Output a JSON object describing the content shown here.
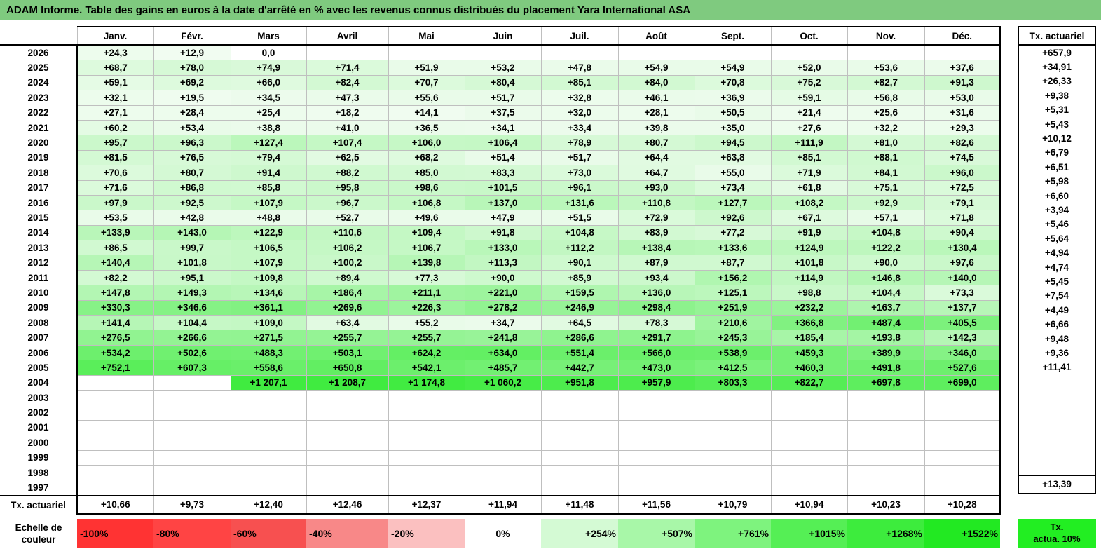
{
  "title": "ADAM Informe. Table des gains en euros à la date d'arrêté en % avec les revenus connus distribués du placement Yara International ASA",
  "months": [
    "Janv.",
    "Févr.",
    "Mars",
    "Avril",
    "Mai",
    "Juin",
    "Juil.",
    "Août",
    "Sept.",
    "Oct.",
    "Nov.",
    "Déc."
  ],
  "side_header": "Tx. actuariel",
  "rows": [
    {
      "year": "2026",
      "values": [
        "+24,3",
        "+12,9",
        "0,0",
        "",
        "",
        "",
        "",
        "",
        "",
        "",
        "",
        ""
      ],
      "rate": "+657,9"
    },
    {
      "year": "2025",
      "values": [
        "+68,7",
        "+78,0",
        "+74,9",
        "+71,4",
        "+51,9",
        "+53,2",
        "+47,8",
        "+54,9",
        "+54,9",
        "+52,0",
        "+53,6",
        "+37,6"
      ],
      "rate": "+34,91"
    },
    {
      "year": "2024",
      "values": [
        "+59,1",
        "+69,2",
        "+66,0",
        "+82,4",
        "+70,7",
        "+80,4",
        "+85,1",
        "+84,0",
        "+70,8",
        "+75,2",
        "+82,7",
        "+91,3"
      ],
      "rate": "+26,33"
    },
    {
      "year": "2023",
      "values": [
        "+32,1",
        "+19,5",
        "+34,5",
        "+47,3",
        "+55,6",
        "+51,7",
        "+32,8",
        "+46,1",
        "+36,9",
        "+59,1",
        "+56,8",
        "+53,0"
      ],
      "rate": "+9,38"
    },
    {
      "year": "2022",
      "values": [
        "+27,1",
        "+28,4",
        "+25,4",
        "+18,2",
        "+14,1",
        "+37,5",
        "+32,0",
        "+28,1",
        "+50,5",
        "+21,4",
        "+25,6",
        "+31,6"
      ],
      "rate": "+5,31"
    },
    {
      "year": "2021",
      "values": [
        "+60,2",
        "+53,4",
        "+38,8",
        "+41,0",
        "+36,5",
        "+34,1",
        "+33,4",
        "+39,8",
        "+35,0",
        "+27,6",
        "+32,2",
        "+29,3"
      ],
      "rate": "+5,43"
    },
    {
      "year": "2020",
      "values": [
        "+95,7",
        "+96,3",
        "+127,4",
        "+107,4",
        "+106,0",
        "+106,4",
        "+78,9",
        "+80,7",
        "+94,5",
        "+111,9",
        "+81,0",
        "+82,6"
      ],
      "rate": "+10,12"
    },
    {
      "year": "2019",
      "values": [
        "+81,5",
        "+76,5",
        "+79,4",
        "+62,5",
        "+68,2",
        "+51,4",
        "+51,7",
        "+64,4",
        "+63,8",
        "+85,1",
        "+88,1",
        "+74,5"
      ],
      "rate": "+6,79"
    },
    {
      "year": "2018",
      "values": [
        "+70,6",
        "+80,7",
        "+91,4",
        "+88,2",
        "+85,0",
        "+83,3",
        "+73,0",
        "+64,7",
        "+55,0",
        "+71,9",
        "+84,1",
        "+96,0"
      ],
      "rate": "+6,51"
    },
    {
      "year": "2017",
      "values": [
        "+71,6",
        "+86,8",
        "+85,8",
        "+95,8",
        "+98,6",
        "+101,5",
        "+96,1",
        "+93,0",
        "+73,4",
        "+61,8",
        "+75,1",
        "+72,5"
      ],
      "rate": "+5,98"
    },
    {
      "year": "2016",
      "values": [
        "+97,9",
        "+92,5",
        "+107,9",
        "+96,7",
        "+106,8",
        "+137,0",
        "+131,6",
        "+110,8",
        "+127,7",
        "+108,2",
        "+92,9",
        "+79,1"
      ],
      "rate": "+6,60"
    },
    {
      "year": "2015",
      "values": [
        "+53,5",
        "+42,8",
        "+48,8",
        "+52,7",
        "+49,6",
        "+47,9",
        "+51,5",
        "+72,9",
        "+92,6",
        "+67,1",
        "+57,1",
        "+71,8"
      ],
      "rate": "+3,94"
    },
    {
      "year": "2014",
      "values": [
        "+133,9",
        "+143,0",
        "+122,9",
        "+110,6",
        "+109,4",
        "+91,8",
        "+104,8",
        "+83,9",
        "+77,2",
        "+91,9",
        "+104,8",
        "+90,4"
      ],
      "rate": "+5,46"
    },
    {
      "year": "2013",
      "values": [
        "+86,5",
        "+99,7",
        "+106,5",
        "+106,2",
        "+106,7",
        "+133,0",
        "+112,2",
        "+138,4",
        "+133,6",
        "+124,9",
        "+122,2",
        "+130,4"
      ],
      "rate": "+5,64"
    },
    {
      "year": "2012",
      "values": [
        "+140,4",
        "+101,8",
        "+107,9",
        "+100,2",
        "+139,8",
        "+113,3",
        "+90,1",
        "+87,9",
        "+87,7",
        "+101,8",
        "+90,0",
        "+97,6"
      ],
      "rate": "+4,94"
    },
    {
      "year": "2011",
      "values": [
        "+82,2",
        "+95,1",
        "+109,8",
        "+89,4",
        "+77,3",
        "+90,0",
        "+85,9",
        "+93,4",
        "+156,2",
        "+114,9",
        "+146,8",
        "+140,0"
      ],
      "rate": "+4,74"
    },
    {
      "year": "2010",
      "values": [
        "+147,8",
        "+149,3",
        "+134,6",
        "+186,4",
        "+211,1",
        "+221,0",
        "+159,5",
        "+136,0",
        "+125,1",
        "+98,8",
        "+104,4",
        "+73,3"
      ],
      "rate": "+5,45"
    },
    {
      "year": "2009",
      "values": [
        "+330,3",
        "+346,6",
        "+361,1",
        "+269,6",
        "+226,3",
        "+278,2",
        "+246,9",
        "+298,4",
        "+251,9",
        "+232,2",
        "+163,7",
        "+137,7"
      ],
      "rate": "+7,54"
    },
    {
      "year": "2008",
      "values": [
        "+141,4",
        "+104,4",
        "+109,0",
        "+63,4",
        "+55,2",
        "+34,7",
        "+64,5",
        "+78,3",
        "+210,6",
        "+366,8",
        "+487,4",
        "+405,5"
      ],
      "rate": "+4,49"
    },
    {
      "year": "2007",
      "values": [
        "+276,5",
        "+266,6",
        "+271,5",
        "+255,7",
        "+255,7",
        "+241,8",
        "+286,6",
        "+291,7",
        "+245,3",
        "+185,4",
        "+193,8",
        "+142,3"
      ],
      "rate": "+6,66"
    },
    {
      "year": "2006",
      "values": [
        "+534,2",
        "+502,6",
        "+488,3",
        "+503,1",
        "+624,2",
        "+634,0",
        "+551,4",
        "+566,0",
        "+538,9",
        "+459,3",
        "+389,9",
        "+346,0"
      ],
      "rate": "+9,48"
    },
    {
      "year": "2005",
      "values": [
        "+752,1",
        "+607,3",
        "+558,6",
        "+650,8",
        "+542,1",
        "+485,7",
        "+442,7",
        "+473,0",
        "+412,5",
        "+460,3",
        "+491,8",
        "+527,6"
      ],
      "rate": "+9,36"
    },
    {
      "year": "2004",
      "values": [
        "",
        "",
        "+1 207,1",
        "+1 208,7",
        "+1 174,8",
        "+1 060,2",
        "+951,8",
        "+957,9",
        "+803,3",
        "+822,7",
        "+697,8",
        "+699,0"
      ],
      "rate": "+11,41"
    },
    {
      "year": "2003",
      "values": [
        "",
        "",
        "",
        "",
        "",
        "",
        "",
        "",
        "",
        "",
        "",
        ""
      ],
      "rate": ""
    },
    {
      "year": "2002",
      "values": [
        "",
        "",
        "",
        "",
        "",
        "",
        "",
        "",
        "",
        "",
        "",
        ""
      ],
      "rate": ""
    },
    {
      "year": "2001",
      "values": [
        "",
        "",
        "",
        "",
        "",
        "",
        "",
        "",
        "",
        "",
        "",
        ""
      ],
      "rate": ""
    },
    {
      "year": "2000",
      "values": [
        "",
        "",
        "",
        "",
        "",
        "",
        "",
        "",
        "",
        "",
        "",
        ""
      ],
      "rate": ""
    },
    {
      "year": "1999",
      "values": [
        "",
        "",
        "",
        "",
        "",
        "",
        "",
        "",
        "",
        "",
        "",
        ""
      ],
      "rate": ""
    },
    {
      "year": "1998",
      "values": [
        "",
        "",
        "",
        "",
        "",
        "",
        "",
        "",
        "",
        "",
        "",
        ""
      ],
      "rate": ""
    },
    {
      "year": "1997",
      "values": [
        "",
        "",
        "",
        "",
        "",
        "",
        "",
        "",
        "",
        "",
        "",
        ""
      ],
      "rate": ""
    }
  ],
  "totals": {
    "label": "Tx. actuariel",
    "values": [
      "+10,66",
      "+9,73",
      "+12,40",
      "+12,46",
      "+12,37",
      "+11,94",
      "+11,48",
      "+11,56",
      "+10,79",
      "+10,94",
      "+10,23",
      "+10,28"
    ],
    "rate": "+13,39"
  },
  "scale": {
    "label": "Echelle de couleur",
    "steps": [
      {
        "label": "-100%",
        "color": "#ff3333"
      },
      {
        "label": "-80%",
        "color": "#ff4444"
      },
      {
        "label": "-60%",
        "color": "#f75050"
      },
      {
        "label": "-40%",
        "color": "#f88888"
      },
      {
        "label": "-20%",
        "color": "#fbc0c0"
      },
      {
        "label": "0%",
        "color": "#ffffff"
      },
      {
        "label": "+254%",
        "color": "#d4fad4"
      },
      {
        "label": "+507%",
        "color": "#a8f7a8"
      },
      {
        "label": "+761%",
        "color": "#7ef37e"
      },
      {
        "label": "+1015%",
        "color": "#55ef55"
      },
      {
        "label": "+1268%",
        "color": "#3dec3d"
      },
      {
        "label": "+1522%",
        "color": "#22e922"
      }
    ],
    "side_label_1": "Tx.",
    "side_label_2": "actua. 10%",
    "side_color": "#22ee22"
  }
}
